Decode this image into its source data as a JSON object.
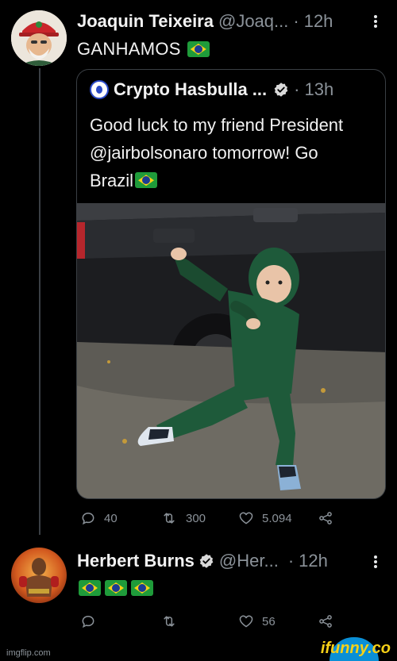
{
  "tweet1": {
    "name": "Joaquin Teixeira",
    "handle": "@Joaq...",
    "dot": "·",
    "time": "12h",
    "text": "GANHAMOS"
  },
  "quote": {
    "name": "Crypto Hasbulla ...",
    "dot": "·",
    "time": "13h",
    "text": "Good luck to my friend President @jairbolsonaro tomorrow! Go Brazil"
  },
  "tweet1_actions": {
    "replies": "40",
    "retweets": "300",
    "likes": "5.094"
  },
  "tweet2": {
    "name": "Herbert Burns",
    "handle": "@Her...",
    "dot": "·",
    "time": "12h"
  },
  "tweet2_actions": {
    "replies": "",
    "retweets": "",
    "likes": "56"
  },
  "footer": {
    "watermark_left": "imgflip.com",
    "watermark_right": "ifunny.co"
  },
  "colors": {
    "background": "#000000",
    "muted_text": "#8b9299",
    "verified_badge": "#d9d9d9",
    "flag_green": "#1f9b3a",
    "flag_yellow": "#f7d117",
    "flag_blue": "#1c3b94"
  },
  "icons": [
    "reply-icon",
    "retweet-icon",
    "like-icon",
    "share-icon",
    "verified-badge-icon",
    "more-options-icon",
    "brazil-flag-emoji"
  ]
}
